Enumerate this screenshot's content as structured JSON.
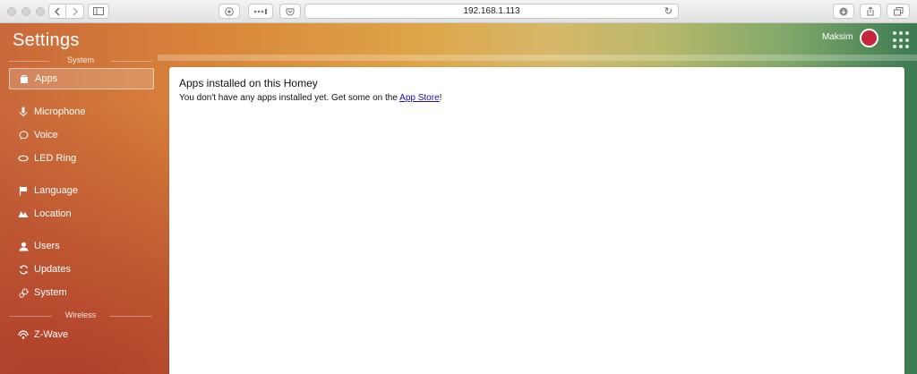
{
  "browser": {
    "address": "192.168.1.113"
  },
  "header": {
    "title": "Settings",
    "user_name": "Maksim"
  },
  "sidebar": {
    "sections": [
      {
        "label": "System"
      },
      {
        "label": "Wireless"
      }
    ],
    "items": [
      {
        "label": "Apps",
        "icon": "bag-icon"
      },
      {
        "label": "Microphone",
        "icon": "microphone-icon"
      },
      {
        "label": "Voice",
        "icon": "speech-bubble-icon"
      },
      {
        "label": "LED Ring",
        "icon": "ring-icon"
      },
      {
        "label": "Language",
        "icon": "flag-icon"
      },
      {
        "label": "Location",
        "icon": "map-icon"
      },
      {
        "label": "Users",
        "icon": "user-icon"
      },
      {
        "label": "Updates",
        "icon": "refresh-icon"
      },
      {
        "label": "System",
        "icon": "gears-icon"
      },
      {
        "label": "Z-Wave",
        "icon": "wireless-icon"
      }
    ]
  },
  "main": {
    "heading": "Apps installed on this Homey",
    "message_before": "You don't have any apps installed yet. Get some on the ",
    "link": "App Store",
    "message_after": "!"
  },
  "colors": {
    "accent_orange": "#d9843a",
    "accent_green": "#3c7a52"
  }
}
